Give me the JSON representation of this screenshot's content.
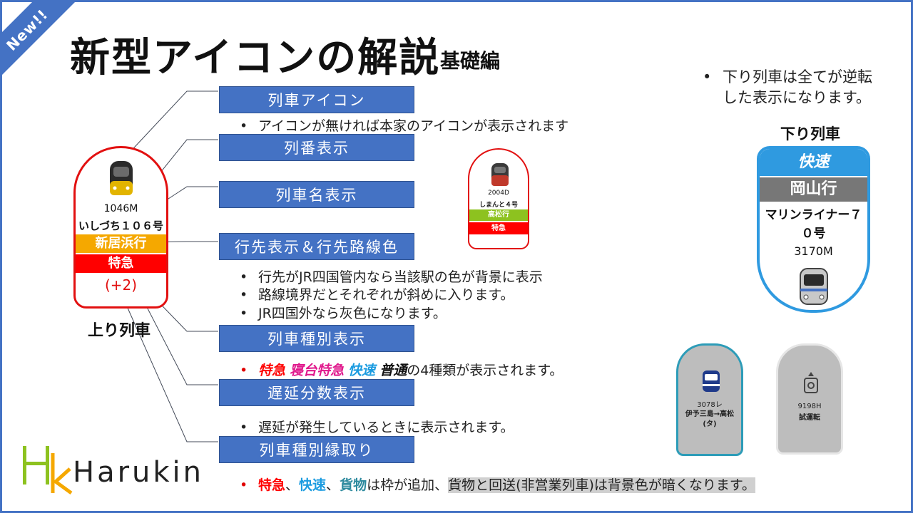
{
  "ribbon": {
    "text": "New!!"
  },
  "header": {
    "title": "新型アイコンの解説",
    "subtitle": "基礎編"
  },
  "boxes": {
    "icon": "列車アイコン",
    "number": "列番表示",
    "name": "列車名表示",
    "destination": "行先表示＆行先路線色",
    "type": "列車種別表示",
    "delay": "遅延分数表示",
    "border": "列車種別縁取り"
  },
  "notes": {
    "bullet": "•",
    "icon_note": "アイコンが無ければ本家のアイコンが表示されます",
    "dest_note_1": "行先がJR四国管内なら当該駅の色が背景に表示",
    "dest_note_2": "路線境界だとそれぞれが斜めに入ります。",
    "dest_note_3": "JR四国外なら灰色になります。",
    "type_note": {
      "ltd": "特急",
      "sleeper": "寝台特急",
      "rapid": "快速",
      "local": "普通",
      "rest": "の4種類が表示されます。"
    },
    "delay_note": "遅延が発生しているときに表示されます。",
    "border_note": {
      "ltd": "特急",
      "sep1": "、",
      "rapid": "快速",
      "sep2": "、",
      "freight": "貨物",
      "mid": "は枠が追加、",
      "highlight": "貨物と回送(非営業列車)は背景色が暗くなります。"
    }
  },
  "icon_up": {
    "number": "1046M",
    "name": "いしづち１０６号",
    "destination": "新居浜行",
    "type": "特急",
    "delay": "(+2)",
    "label": "上り列車"
  },
  "icon_small": {
    "number": "2004D",
    "name": "しまんと４号",
    "destination": "高松行",
    "type": "特急"
  },
  "down": {
    "note_line1": "下り列車は全てが逆転",
    "note_line2": "した表示になります。",
    "label": "下り列車",
    "type": "快速",
    "destination": "岡山行",
    "name_line1": "マリンライナー７",
    "name_line2": "０号",
    "number": "3170M"
  },
  "gray1": {
    "number": "3078レ",
    "name_line1": "伊予三島→高松",
    "name_line2": "(タ)"
  },
  "gray2": {
    "number": "9198H",
    "name": "試運転"
  },
  "logo": {
    "text": "Harukin"
  },
  "colors": {
    "accent": "#4472c4",
    "ltd_red": "#ff0000",
    "sleeper_pink": "#e0188c",
    "rapid_blue": "#1a9be0",
    "dest_orange": "#f5a800",
    "dest_green": "#8dc21f"
  }
}
